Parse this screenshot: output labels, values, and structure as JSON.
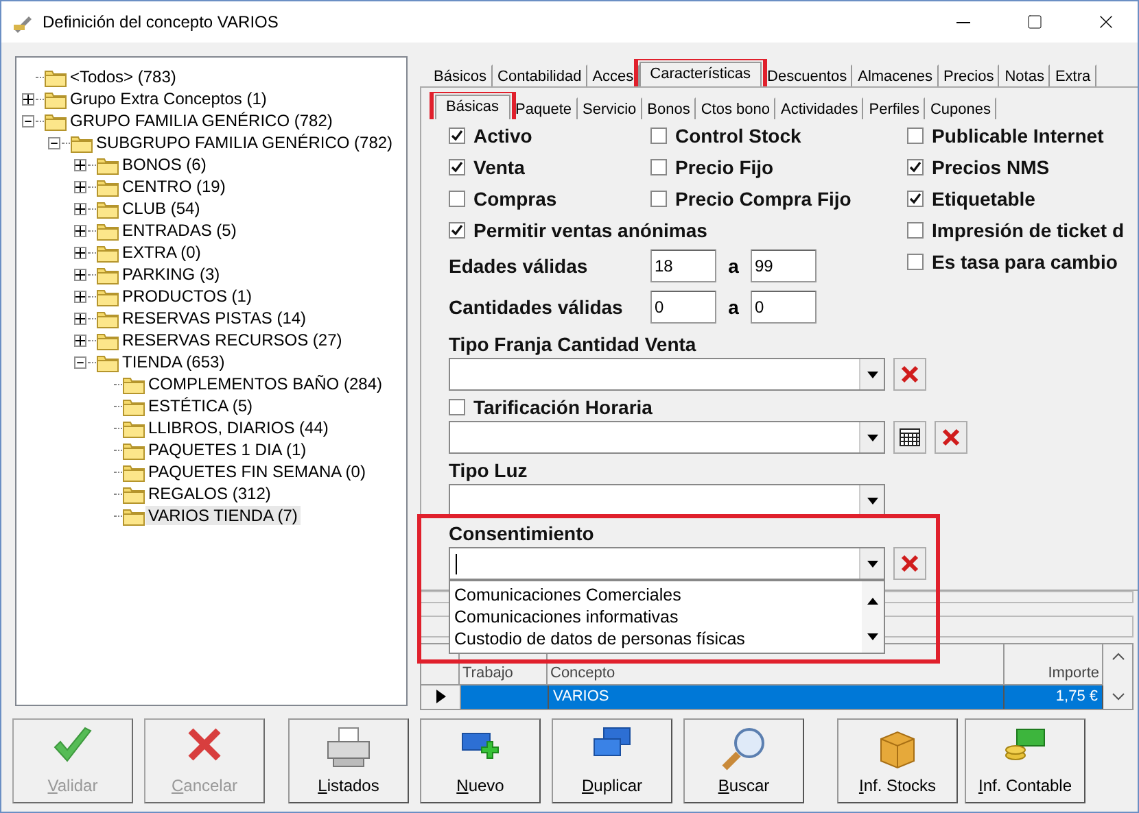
{
  "window": {
    "title": "Definición del concepto VARIOS"
  },
  "tree": [
    {
      "label": "<Todos> (783)",
      "selected": false
    },
    {
      "label": "Grupo Extra Conceptos (1)",
      "expanded": false,
      "selected": false
    },
    {
      "label": "GRUPO FAMILIA GENÉRICO (782)",
      "expanded": true,
      "selected": false,
      "children": [
        {
          "label": "SUBGRUPO FAMILIA GENÉRICO (782)",
          "expanded": true,
          "selected": false,
          "children": [
            {
              "label": "BONOS (6)",
              "expanded": false,
              "selected": false
            },
            {
              "label": "CENTRO (19)",
              "expanded": false,
              "selected": false
            },
            {
              "label": "CLUB (54)",
              "expanded": false,
              "selected": false
            },
            {
              "label": "ENTRADAS (5)",
              "expanded": false,
              "selected": false
            },
            {
              "label": "EXTRA (0)",
              "expanded": false,
              "selected": false
            },
            {
              "label": "PARKING (3)",
              "expanded": false,
              "selected": false
            },
            {
              "label": "PRODUCTOS (1)",
              "expanded": false,
              "selected": false
            },
            {
              "label": "RESERVAS PISTAS (14)",
              "expanded": false,
              "selected": false
            },
            {
              "label": "RESERVAS RECURSOS (27)",
              "expanded": false,
              "selected": false
            },
            {
              "label": "TIENDA (653)",
              "expanded": true,
              "selected": false,
              "children": [
                {
                  "label": "COMPLEMENTOS BAÑO (284)",
                  "selected": false
                },
                {
                  "label": "ESTÉTICA (5)",
                  "selected": false
                },
                {
                  "label": "LLIBROS, DIARIOS (44)",
                  "selected": false
                },
                {
                  "label": "PAQUETES 1 DIA (1)",
                  "selected": false
                },
                {
                  "label": "PAQUETES FIN SEMANA (0)",
                  "selected": false
                },
                {
                  "label": "REGALOS (312)",
                  "selected": false
                },
                {
                  "label": "VARIOS TIENDA (7)",
                  "selected": true
                }
              ]
            }
          ]
        }
      ]
    }
  ],
  "tabs": [
    {
      "label": "Básicos",
      "selected": false,
      "highlighted": false
    },
    {
      "label": "Contabilidad",
      "selected": false,
      "highlighted": false
    },
    {
      "label": "Acces",
      "selected": false,
      "highlighted": false
    },
    {
      "label": "Características",
      "selected": true,
      "highlighted": true
    },
    {
      "label": "Descuentos",
      "selected": false,
      "highlighted": false
    },
    {
      "label": "Almacenes",
      "selected": false,
      "highlighted": false
    },
    {
      "label": "Precios",
      "selected": false,
      "highlighted": false
    },
    {
      "label": "Notas",
      "selected": false,
      "highlighted": false
    },
    {
      "label": "Extra",
      "selected": false,
      "highlighted": false
    }
  ],
  "subtabs": [
    {
      "label": "Básicas",
      "selected": true,
      "highlighted": true
    },
    {
      "label": "Paquete",
      "selected": false,
      "highlighted": false
    },
    {
      "label": "Servicio",
      "selected": false,
      "highlighted": false
    },
    {
      "label": "Bonos",
      "selected": false,
      "highlighted": false
    },
    {
      "label": "Ctos bono",
      "selected": false,
      "highlighted": false
    },
    {
      "label": "Actividades",
      "selected": false,
      "highlighted": false
    },
    {
      "label": "Perfiles",
      "selected": false,
      "highlighted": false
    },
    {
      "label": "Cupones",
      "selected": false,
      "highlighted": false
    }
  ],
  "checkbox_columns": [
    [
      {
        "label": "Activo",
        "checked": true
      },
      {
        "label": "Venta",
        "checked": true
      },
      {
        "label": "Compras",
        "checked": false
      },
      {
        "label": "Permitir ventas anónimas",
        "checked": true
      }
    ],
    [
      {
        "label": "Control Stock",
        "checked": false
      },
      {
        "label": "Precio Fijo",
        "checked": false
      },
      {
        "label": "Precio Compra Fijo",
        "checked": false
      }
    ],
    [
      {
        "label": "Publicable Internet",
        "checked": false
      },
      {
        "label": "Precios NMS",
        "checked": true
      },
      {
        "label": "Etiquetable",
        "checked": true
      },
      {
        "label": "Impresión de ticket d",
        "checked": false
      },
      {
        "label": "Es tasa para cambio",
        "checked": false
      }
    ]
  ],
  "ranges": [
    {
      "label": "Edades válidas",
      "from": "18",
      "separator": "a",
      "to": "99"
    },
    {
      "label": "Cantidades válidas",
      "from": "0",
      "separator": "a",
      "to": "0"
    }
  ],
  "selects": [
    {
      "label": "Tipo Franja Cantidad Venta",
      "clear_button": true
    },
    {
      "label": "Tarificación Horaria",
      "checkbox": {
        "checked": false
      },
      "clear_button": true,
      "calendar_button": true
    },
    {
      "label": "Tipo Luz"
    },
    {
      "label": "Consentimiento",
      "clear_button": true,
      "focused": true,
      "highlighted": true,
      "options": [
        "Comunicaciones Comerciales",
        "Comunicaciones informativas",
        "Custodio de datos de personas físicas"
      ]
    }
  ],
  "table": {
    "columns": [
      "Trabajo",
      "Concepto",
      "Importe"
    ],
    "rows": [
      {
        "cells": [
          "",
          "VARIOS",
          "1,75 €"
        ],
        "selected": true
      }
    ]
  },
  "buttons": [
    {
      "label": "Validar",
      "kind": "check",
      "disabled": true
    },
    {
      "label": "Cancelar",
      "kind": "cross",
      "disabled": true
    },
    {
      "label": "Listados",
      "kind": "printer",
      "disabled": false
    },
    {
      "label": "Nuevo",
      "kind": "new",
      "disabled": false
    },
    {
      "label": "Duplicar",
      "kind": "duplicate",
      "disabled": false
    },
    {
      "label": "Buscar",
      "kind": "search",
      "disabled": false
    },
    {
      "label": "Inf. Stocks",
      "kind": "box",
      "disabled": false
    },
    {
      "label": "Inf. Contable",
      "kind": "money",
      "disabled": false
    }
  ]
}
